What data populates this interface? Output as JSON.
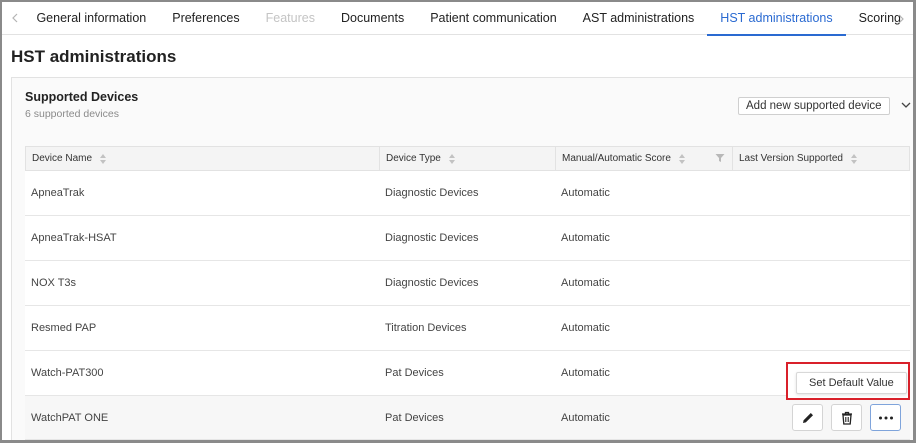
{
  "tabs": [
    {
      "label": "General information",
      "state": "normal"
    },
    {
      "label": "Preferences",
      "state": "normal"
    },
    {
      "label": "Features",
      "state": "disabled"
    },
    {
      "label": "Documents",
      "state": "normal"
    },
    {
      "label": "Patient communication",
      "state": "normal"
    },
    {
      "label": "AST administrations",
      "state": "normal"
    },
    {
      "label": "HST administrations",
      "state": "active"
    },
    {
      "label": "Scoring",
      "state": "normal"
    }
  ],
  "page_title": "HST administrations",
  "section": {
    "title": "Supported Devices",
    "subtitle": "6 supported devices",
    "add_button_label": "Add new supported device"
  },
  "table": {
    "columns": [
      "Device Name",
      "Device Type",
      "Manual/Automatic Score",
      "Last Version Supported"
    ],
    "rows": [
      {
        "name": "ApneaTrak",
        "type": "Diagnostic Devices",
        "score": "Automatic",
        "version": ""
      },
      {
        "name": "ApneaTrak-HSAT",
        "type": "Diagnostic Devices",
        "score": "Automatic",
        "version": ""
      },
      {
        "name": "NOX T3s",
        "type": "Diagnostic Devices",
        "score": "Automatic",
        "version": ""
      },
      {
        "name": "Resmed PAP",
        "type": "Titration Devices",
        "score": "Automatic",
        "version": ""
      },
      {
        "name": "Watch-PAT300",
        "type": "Pat Devices",
        "score": "Automatic",
        "version": ""
      },
      {
        "name": "WatchPAT ONE",
        "type": "Pat Devices",
        "score": "Automatic",
        "version": ""
      }
    ]
  },
  "tooltip_label": "Set Default Value",
  "colors": {
    "accent": "#2a6ad1",
    "highlight": "#d9202a"
  },
  "icons": [
    "chevron-left-icon",
    "chevron-right-icon",
    "chevron-down-icon",
    "sort-icon",
    "filter-icon",
    "pencil-icon",
    "trash-icon",
    "more-horizontal-icon"
  ]
}
